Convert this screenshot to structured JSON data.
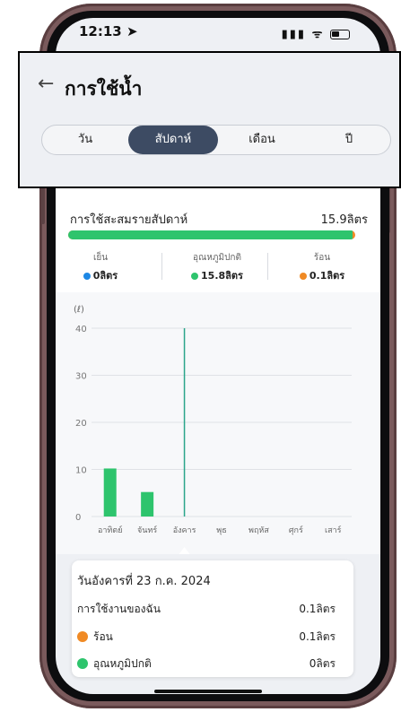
{
  "status_bar": {
    "time": "12:13 ➤",
    "signal": "▮▮▮ ᯤ"
  },
  "header": {
    "title": "การใช้น้ำ"
  },
  "segments": [
    {
      "label": "วัน",
      "active": false
    },
    {
      "label": "สัปดาห์",
      "active": true
    },
    {
      "label": "เดือน",
      "active": false
    },
    {
      "label": "ปี",
      "active": false
    }
  ],
  "summary": {
    "label": "การใช้สะสมรายสัปดาห์",
    "total": "15.9ลิตร",
    "normal_share": 0.99,
    "categories": [
      {
        "name": "เย็น",
        "value": "0ลิตร",
        "color": "#1e88e5"
      },
      {
        "name": "อุณหภูมิปกติ",
        "value": "15.8ลิตร",
        "color": "#2ec46d"
      },
      {
        "name": "ร้อน",
        "value": "0.1ลิตร",
        "color": "#f08a24"
      }
    ]
  },
  "chart_data": {
    "type": "bar",
    "ylabel": "(ℓ)",
    "ylim": [
      0,
      40
    ],
    "yticks": [
      "0",
      "10",
      "20",
      "30",
      "40"
    ],
    "categories": [
      "อาทิตย์",
      "จันทร์",
      "อังคาร",
      "พุธ",
      "พฤหัส",
      "ศุกร์",
      "เสาร์"
    ],
    "values": [
      10.2,
      5.2,
      0,
      0,
      0,
      0,
      0
    ],
    "bar_color": "#2ec46d",
    "selected_index": 2,
    "grid": true
  },
  "detail": {
    "date": "วันอังคารที่ 23 ก.ค. 2024",
    "usage_label": "การใช้งานของฉัน",
    "usage_value": "0.1ลิตร",
    "rows": [
      {
        "name": "ร้อน",
        "value": "0.1ลิตร",
        "color": "#f08a24"
      },
      {
        "name": "อุณหภูมิปกติ",
        "value": "0ลิตร",
        "color": "#2ec46d"
      }
    ]
  }
}
